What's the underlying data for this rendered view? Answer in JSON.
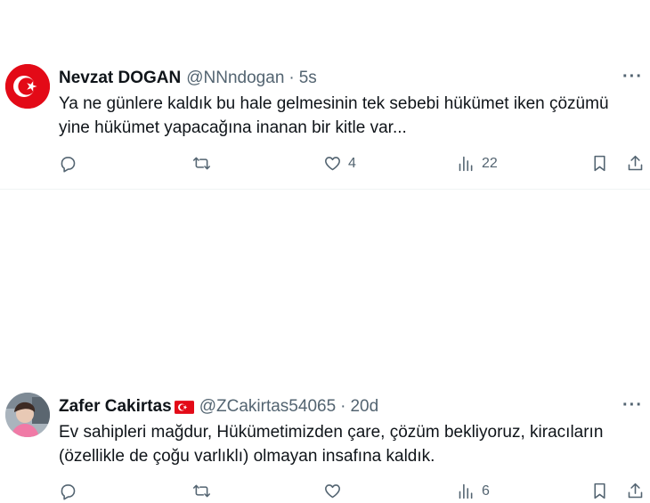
{
  "tweets": [
    {
      "author_name": "Nevzat DOGAN",
      "handle": "@NNndogan",
      "separator": "·",
      "time": "5s",
      "has_flag": false,
      "text_lines": [
        "Ya ne günlere kaldık bu hale gelmesinin tek sebebi hükümet iken çözümü",
        "yine hükümet yapacağına inanan bir kitle var..."
      ],
      "replies": "",
      "reposts": "",
      "likes": "4",
      "views": "22",
      "avatar_icon": "turkish-flag-icon"
    },
    {
      "author_name": "Zafer Cakirtas",
      "handle": "@ZCakirtas54065",
      "separator": "·",
      "time": "20d",
      "has_flag": true,
      "text_lines": [
        "Ev sahipleri mağdur, Hükümetimizden çare, çözüm bekliyoruz, kiracıların",
        "(özellikle de çoğu varlıklı) olmayan insafına kaldık."
      ],
      "replies": "",
      "reposts": "",
      "likes": "",
      "views": "6",
      "avatar_icon": "user-photo"
    }
  ],
  "more_label": "···",
  "colors": {
    "text": "#0f1419",
    "secondary": "#536471",
    "flag_red": "#e30a17",
    "divider": "#eff3f4"
  }
}
